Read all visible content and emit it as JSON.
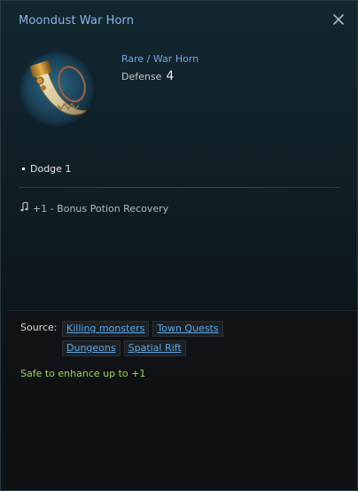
{
  "item": {
    "name": "Moondust War Horn",
    "rarity_type": "Rare / War Horn",
    "defense_label": "Defense",
    "defense_value": "4",
    "icon": "war-horn-icon"
  },
  "stats": [
    {
      "label": "Dodge 1"
    }
  ],
  "effect": {
    "text": "+1 - Bonus Potion Recovery",
    "icon": "music-note-icon"
  },
  "source": {
    "label": "Source:",
    "tags": [
      "Killing monsters",
      "Town Quests",
      "Dungeons",
      "Spatial Rift"
    ]
  },
  "enhance_text": "Safe to enhance up to +1",
  "window": {
    "close_icon": "close-icon"
  },
  "colors": {
    "title": "#8ab6e6",
    "rarity": "#6fa9e8",
    "link": "#5aa7ea",
    "enhance": "#9ed65a"
  }
}
